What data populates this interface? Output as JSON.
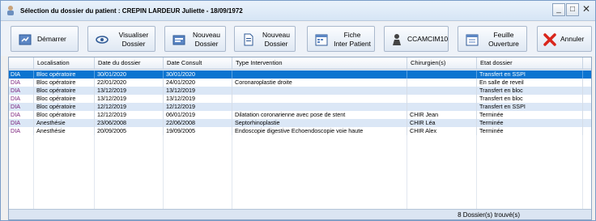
{
  "window": {
    "title": "Sélection du dossier du patient : CREPIN LARDEUR Juliette - 18/09/1972",
    "controls": {
      "minimize": "_",
      "maximize": "□",
      "close": "✕"
    }
  },
  "toolbar": {
    "buttons": [
      {
        "id": "demarrer",
        "label": "Démarrer",
        "icon": "start-icon"
      },
      {
        "id": "visualiser",
        "label_line1": "Visualiser",
        "label_line2": "Dossier",
        "icon": "eye-icon"
      },
      {
        "id": "nouveau1",
        "label_line1": "Nouveau",
        "label_line2": "Dossier",
        "icon": "new-folder-icon"
      },
      {
        "id": "nouveau2",
        "label_line1": "Nouveau",
        "label_line2": "Dossier",
        "icon": "document-icon"
      },
      {
        "id": "fiche",
        "label_line1": "Fiche",
        "label_line2": "Inter Patient",
        "icon": "calendar-icon"
      },
      {
        "id": "ccam",
        "label": "CCAMCIM10",
        "icon": "person-icon"
      },
      {
        "id": "feuille",
        "label_line1": "Feuille",
        "label_line2": "Ouverture",
        "icon": "sheet-icon"
      },
      {
        "id": "annuler",
        "label": "Annuler",
        "icon": "cancel-icon"
      }
    ]
  },
  "grid": {
    "columns": [
      "Localisation",
      "Date du dossier",
      "Date Consult",
      "Type Intervention",
      "Chirurgien(s)",
      "Etat dossier"
    ],
    "rows": [
      {
        "tag": "DIA",
        "localisation": "Bloc opératoire",
        "date_dossier": "30/01/2020",
        "date_consult": "30/01/2020",
        "type": "",
        "chirurgien": "",
        "etat": "Transfert en SSPI"
      },
      {
        "tag": "DIA",
        "localisation": "Bloc opératoire",
        "date_dossier": "22/01/2020",
        "date_consult": "24/01/2020",
        "type": "Coronaroplastie droite",
        "chirurgien": "",
        "etat": "En salle de reveil"
      },
      {
        "tag": "DIA",
        "localisation": "Bloc opératoire",
        "date_dossier": "13/12/2019",
        "date_consult": "13/12/2019",
        "type": "",
        "chirurgien": "",
        "etat": "Transfert en bloc"
      },
      {
        "tag": "DIA",
        "localisation": "Bloc opératoire",
        "date_dossier": "13/12/2019",
        "date_consult": "13/12/2019",
        "type": "",
        "chirurgien": "",
        "etat": "Transfert en bloc"
      },
      {
        "tag": "DIA",
        "localisation": "Bloc opératoire",
        "date_dossier": "12/12/2019",
        "date_consult": "12/12/2019",
        "type": "",
        "chirurgien": "",
        "etat": "Transfert en SSPI"
      },
      {
        "tag": "DIA",
        "localisation": "Bloc opératoire",
        "date_dossier": "12/12/2019",
        "date_consult": "06/01/2019",
        "type": "Dilatation coronarienne avec pose de stent",
        "chirurgien": "CHIR Jean",
        "etat": "Terminée"
      },
      {
        "tag": "DIA",
        "localisation": "Anesthésie",
        "date_dossier": "23/06/2008",
        "date_consult": "22/06/2008",
        "type": "Septorhinoplastie",
        "chirurgien": "CHIR Léa",
        "etat": "Terminée"
      },
      {
        "tag": "DIA",
        "localisation": "Anesthésie",
        "date_dossier": "20/09/2005",
        "date_consult": "19/09/2005",
        "type": "Endoscopie digestive Echoendoscopie voie haute",
        "chirurgien": "CHIR Alex",
        "etat": "Terminée"
      }
    ],
    "selected_row": 0
  },
  "status": {
    "text": "8 Dossier(s) trouvé(s)"
  },
  "colors": {
    "selection": "#0b74d0",
    "alt_row": "#dbe7f6",
    "cancel_red": "#d9261c"
  }
}
